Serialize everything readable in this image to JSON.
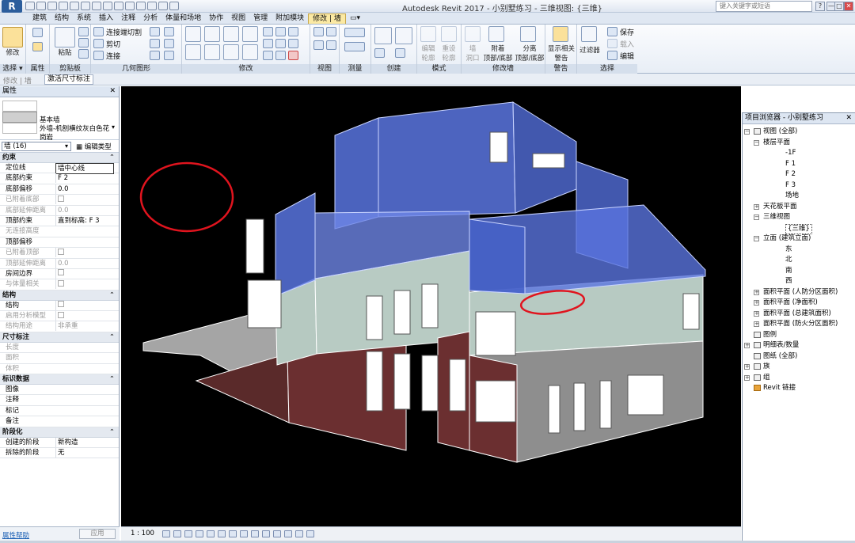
{
  "app": {
    "logo": "R",
    "title": "Autodesk Revit 2017 -    小别墅练习 - 三维视图: {三维}",
    "search_placeholder": "键入关键字或短语",
    "window_buttons": [
      "?",
      "—",
      "□",
      "✕"
    ]
  },
  "tabs": [
    "建筑",
    "结构",
    "系统",
    "插入",
    "注释",
    "分析",
    "体量和场地",
    "协作",
    "视图",
    "管理",
    "附加模块",
    "修改 | 墙"
  ],
  "ribbon": {
    "modify_label": "修改",
    "paste_label": "粘贴",
    "cut_join": "连接端切割",
    "cut": "剪切",
    "join": "连接",
    "edit_profile": "编辑\n轮廓",
    "reset_profile": "重设\n轮廓",
    "wall_opening": "墙\n洞口",
    "attach_top": "附着\n顶部/底部",
    "detach_top": "分离\n顶部/底部",
    "show_related": "显示相关\n警告",
    "filter": "过滤器",
    "save": "保存",
    "load": "载入",
    "edit": "编辑",
    "groups": [
      "选择 ▾",
      "属性",
      "剪贴板",
      "几何图形",
      "修改",
      "视图",
      "测量",
      "创建",
      "模式",
      "修改墙",
      "警告",
      "选择"
    ]
  },
  "context_bar": {
    "left": "修改 | 墙",
    "tool": "激活尺寸标注"
  },
  "properties": {
    "title": "属性",
    "close": "✕",
    "type_family": "基本墙",
    "type_name_1": "外墙-机刨横纹灰白色花",
    "type_name_2": "岗岩",
    "instance_selector": "墙 (16)",
    "edit_type": "编辑类型",
    "sections": [
      {
        "title": "约束",
        "rows": [
          {
            "name": "定位线",
            "value": "墙中心线",
            "dim": false
          },
          {
            "name": "底部约束",
            "value": "F 2",
            "dim": false
          },
          {
            "name": "底部偏移",
            "value": "0.0",
            "dim": false
          },
          {
            "name": "已附着底部",
            "value": "",
            "dim": true,
            "checkbox": true
          },
          {
            "name": "底部延伸距离",
            "value": "0.0",
            "dim": true
          },
          {
            "name": "顶部约束",
            "value": "直到标高: F 3",
            "dim": false
          },
          {
            "name": "无连接高度",
            "value": "",
            "dim": true
          },
          {
            "name": "顶部偏移",
            "value": "",
            "dim": false
          },
          {
            "name": "已附着顶部",
            "value": "",
            "dim": true,
            "checkbox": true
          },
          {
            "name": "顶部延伸距离",
            "value": "0.0",
            "dim": true
          },
          {
            "name": "房间边界",
            "value": "",
            "dim": false,
            "checkbox": true
          },
          {
            "name": "与体量相关",
            "value": "",
            "dim": true,
            "checkbox": true
          }
        ]
      },
      {
        "title": "结构",
        "rows": [
          {
            "name": "结构",
            "value": "",
            "dim": false,
            "checkbox": true
          },
          {
            "name": "启用分析模型",
            "value": "",
            "dim": true,
            "checkbox": true
          },
          {
            "name": "结构用途",
            "value": "非承重",
            "dim": true
          }
        ]
      },
      {
        "title": "尺寸标注",
        "rows": [
          {
            "name": "长度",
            "value": "",
            "dim": true
          },
          {
            "name": "面积",
            "value": "",
            "dim": true
          },
          {
            "name": "体积",
            "value": "",
            "dim": true
          }
        ]
      },
      {
        "title": "标识数据",
        "rows": [
          {
            "name": "图像",
            "value": "",
            "dim": false
          },
          {
            "name": "注释",
            "value": "",
            "dim": false
          },
          {
            "name": "标记",
            "value": "",
            "dim": false
          },
          {
            "name": "备注",
            "value": "",
            "dim": false
          }
        ]
      },
      {
        "title": "阶段化",
        "rows": [
          {
            "name": "创建的阶段",
            "value": "新构造",
            "dim": false
          },
          {
            "name": "拆除的阶段",
            "value": "无",
            "dim": false
          }
        ]
      }
    ],
    "help_link": "属性帮助",
    "apply": "应用"
  },
  "view": {
    "scale": "1 : 100",
    "annotation_color": "#e0141e",
    "selected_wall_color": "#3a5cd8"
  },
  "browser": {
    "title": "项目浏览器 - 小别墅练习",
    "close": "✕",
    "nodes": [
      {
        "label": "视图 (全部)",
        "level": 0,
        "toggle": "−",
        "icon": "views"
      },
      {
        "label": "楼层平面",
        "level": 1,
        "toggle": "−"
      },
      {
        "label": "-1F",
        "level": 3
      },
      {
        "label": "F 1",
        "level": 3
      },
      {
        "label": "F 2",
        "level": 3
      },
      {
        "label": "F 3",
        "level": 3
      },
      {
        "label": "场地",
        "level": 3
      },
      {
        "label": "天花板平面",
        "level": 1,
        "toggle": "+"
      },
      {
        "label": "三维视图",
        "level": 1,
        "toggle": "−"
      },
      {
        "label": "{三维}",
        "level": 3,
        "selected": true
      },
      {
        "label": "立面 (建筑立面)",
        "level": 1,
        "toggle": "−"
      },
      {
        "label": "东",
        "level": 3
      },
      {
        "label": "北",
        "level": 3
      },
      {
        "label": "南",
        "level": 3
      },
      {
        "label": "西",
        "level": 3
      },
      {
        "label": "面积平面 (人防分区面积)",
        "level": 1,
        "toggle": "+"
      },
      {
        "label": "面积平面 (净面积)",
        "level": 1,
        "toggle": "+"
      },
      {
        "label": "面积平面 (总建筑面积)",
        "level": 1,
        "toggle": "+"
      },
      {
        "label": "面积平面 (防火分区面积)",
        "level": 1,
        "toggle": "+"
      },
      {
        "label": "图例",
        "level": 0,
        "icon": "legend"
      },
      {
        "label": "明细表/数量",
        "level": 0,
        "toggle": "+",
        "icon": "schedule"
      },
      {
        "label": "图纸 (全部)",
        "level": 0,
        "icon": "sheet"
      },
      {
        "label": "族",
        "level": 0,
        "toggle": "+",
        "icon": "family"
      },
      {
        "label": "组",
        "level": 0,
        "toggle": "+",
        "icon": "group"
      },
      {
        "label": "Revit 链接",
        "level": 0,
        "icon": "link"
      }
    ]
  }
}
